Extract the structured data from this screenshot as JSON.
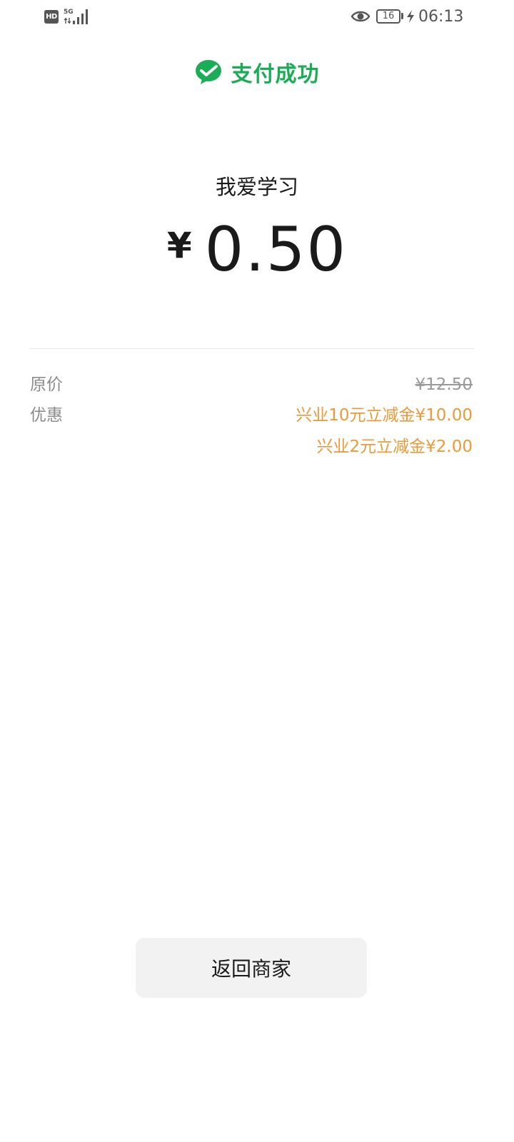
{
  "status_bar": {
    "hd_label": "HD",
    "network_label": "5G",
    "time": "06:13",
    "battery_level": "16",
    "icons": [
      "signal-icon",
      "eye-icon",
      "battery-icon",
      "charging-icon"
    ]
  },
  "header": {
    "icon": "wechat-pay-icon",
    "title": "支付成功",
    "accent_color": "#1aad56"
  },
  "payment": {
    "merchant": "我爱学习",
    "currency_symbol": "¥",
    "amount": "0.50"
  },
  "details": {
    "original_price_label": "原价",
    "original_price": "¥12.50",
    "discount_label": "优惠",
    "discounts": [
      {
        "name": "兴业10元立减金",
        "amount": "¥10.00"
      },
      {
        "name": "兴业2元立减金",
        "amount": "¥2.00"
      }
    ],
    "discount_color": "#eb9a3a"
  },
  "actions": {
    "back_label": "返回商家"
  }
}
